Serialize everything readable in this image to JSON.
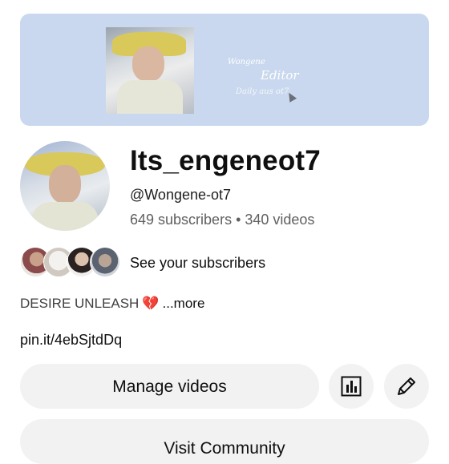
{
  "banner": {
    "line1": "Wongene",
    "line2": "Editor",
    "line3": "Daily aus ot7"
  },
  "channel": {
    "name": "Its_engeneot7",
    "handle": "@Wongene-ot7",
    "stats": "649 subscribers • 340 videos"
  },
  "subscribers": {
    "label": "See your subscribers"
  },
  "description": {
    "text": "DESIRE UNLEASH",
    "emoji": "💔",
    "more": "...more"
  },
  "link": "pin.it/4ebSjtdDq",
  "actions": {
    "manage_videos": "Manage videos",
    "visit_community": "Visit Community",
    "analytics_icon": "analytics-icon",
    "edit_icon": "pencil-icon"
  },
  "colors": {
    "banner_bg": "#c9d8ee",
    "button_bg": "#f2f2f2",
    "secondary_text": "#606060"
  }
}
